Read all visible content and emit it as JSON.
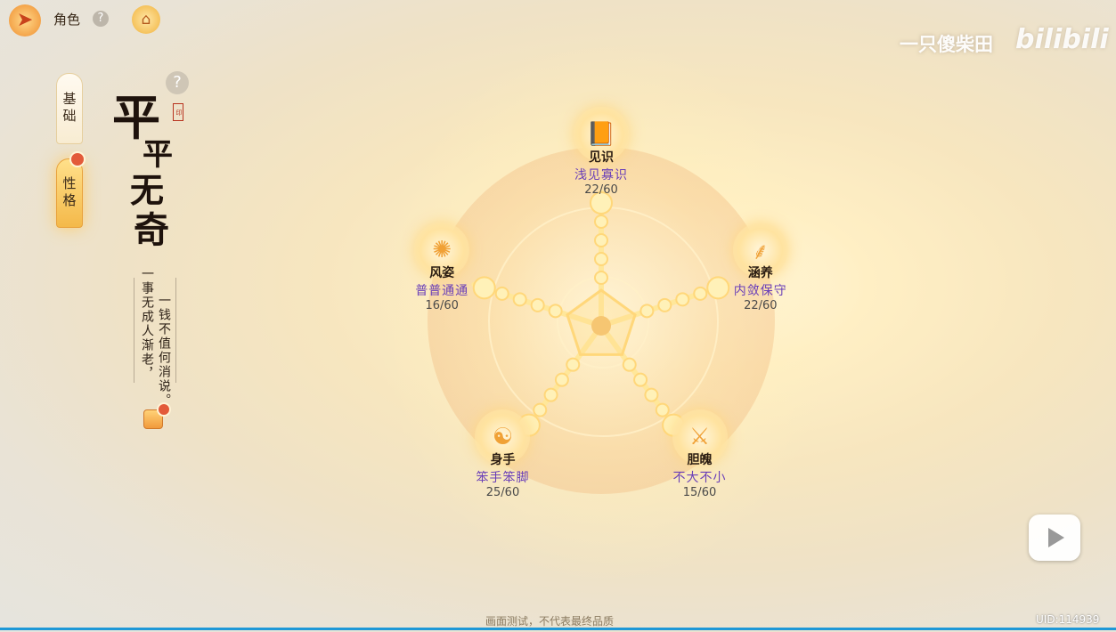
{
  "topbar": {
    "back_icon": "back-arrow-icon",
    "title": "角色",
    "help": "?",
    "home_icon": "house-icon"
  },
  "tabs": [
    {
      "label": "基础",
      "selected": false
    },
    {
      "label": "性格",
      "selected": true
    }
  ],
  "personality": {
    "title_chars": [
      "平",
      "平",
      "无",
      "奇"
    ],
    "seal_text": "印",
    "help": "?",
    "quote_lines": [
      "一事无成人渐老，",
      "一钱不值何消说。"
    ]
  },
  "traits": [
    {
      "name": "见识",
      "level": "浅见寡识",
      "score": "22/60",
      "icon": "book-icon",
      "value": 22,
      "max": 60
    },
    {
      "name": "涵养",
      "level": "内敛保守",
      "score": "22/60",
      "icon": "bamboo-icon",
      "value": 22,
      "max": 60
    },
    {
      "name": "胆魄",
      "level": "不大不小",
      "score": "15/60",
      "icon": "warrior-icon",
      "value": 15,
      "max": 60
    },
    {
      "name": "身手",
      "level": "笨手笨脚",
      "score": "25/60",
      "icon": "martial-arts-icon",
      "value": 25,
      "max": 60
    },
    {
      "name": "风姿",
      "level": "普普通通",
      "score": "16/60",
      "icon": "fan-icon",
      "value": 16,
      "max": 60
    }
  ],
  "watermark": {
    "author": "一只傻柴田",
    "logo": "bilibili",
    "uid": "UID:114939",
    "note": "画面测试，不代表最终品质"
  },
  "colors": {
    "accent": "#f4b94a",
    "level_text": "#6a3fb8",
    "badge": "#e35a3a",
    "progress": "#1e98d7"
  }
}
